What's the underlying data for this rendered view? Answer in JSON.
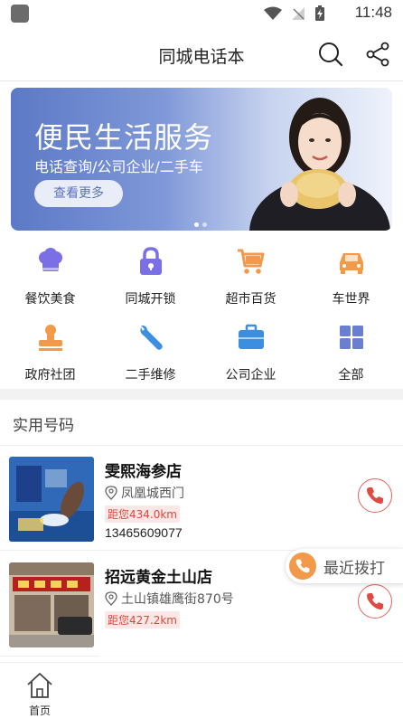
{
  "status_bar": {
    "time": "11:48"
  },
  "header": {
    "title": "同城电话本"
  },
  "banner": {
    "title": "便民生活服务",
    "subtitle": "电话查询/公司企业/二手车",
    "button_label": "查看更多",
    "gradient_start": "#5c79c6"
  },
  "categories": [
    {
      "label": "餐饮美食",
      "icon": "chef-hat-icon",
      "color": "#7b6fe6"
    },
    {
      "label": "同城开锁",
      "icon": "lock-icon",
      "color": "#7b6fe6"
    },
    {
      "label": "超市百货",
      "icon": "shopping-cart-icon",
      "color": "#f2994a"
    },
    {
      "label": "车世界",
      "icon": "car-icon",
      "color": "#f2994a"
    },
    {
      "label": "政府社团",
      "icon": "stamp-icon",
      "color": "#f2994a"
    },
    {
      "label": "二手维修",
      "icon": "wrench-icon",
      "color": "#3b8ee0"
    },
    {
      "label": "公司企业",
      "icon": "briefcase-icon",
      "color": "#3b8ee0"
    },
    {
      "label": "全部",
      "icon": "grid-icon",
      "color": "#6b7fd0"
    }
  ],
  "section": {
    "title": "实用号码"
  },
  "listings": [
    {
      "name": "雯熙海参店",
      "address": "凤凰城西门",
      "distance": "距您434.0km",
      "phone": "13465609077"
    },
    {
      "name": "招远黄金土山店",
      "address": "土山镇雄鹰街870号",
      "distance": "距您427.2km",
      "phone": ""
    }
  ],
  "recent": {
    "label": "最近拨打"
  },
  "bottom_nav": {
    "home_label": "首页"
  },
  "colors": {
    "accent_red": "#e8625b",
    "accent_orange": "#f2994a",
    "accent_purple": "#7b6fe6"
  }
}
